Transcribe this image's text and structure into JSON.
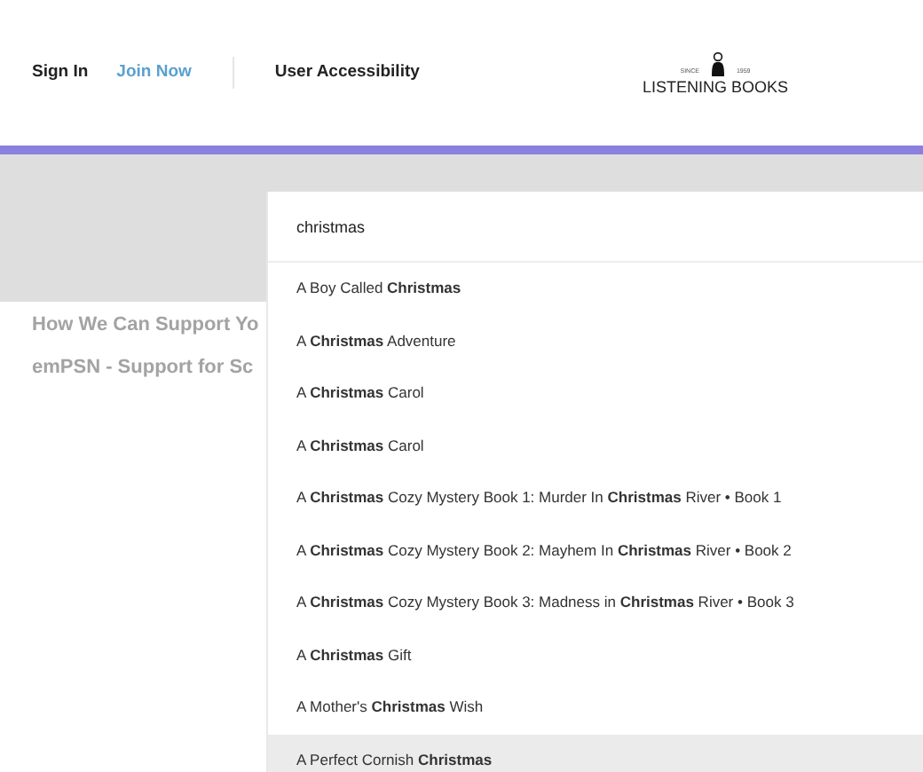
{
  "header": {
    "links": [
      {
        "label": "Sign In",
        "kind": "plain"
      },
      {
        "label": "Join Now",
        "kind": "accent"
      },
      {
        "label": "User Accessibility",
        "kind": "plain"
      }
    ],
    "logo": {
      "since": "SINCE",
      "year": "1959",
      "name": "LISTENING BOOKS"
    }
  },
  "menu_items": [
    "How We Can Support Yo",
    "emPSN - Support for Sc"
  ],
  "search": {
    "value": "christmas",
    "results": [
      {
        "title": "A Boy Called **Christmas**",
        "selected": false
      },
      {
        "title": "A **Christmas** Adventure",
        "selected": false
      },
      {
        "title": "A **Christmas** Carol",
        "selected": false
      },
      {
        "title": "A **Christmas** Carol",
        "selected": false
      },
      {
        "title": "A **Christmas** Cozy Mystery Book 1: Murder In **Christmas** River • Book 1",
        "selected": false
      },
      {
        "title": "A **Christmas** Cozy Mystery Book 2: Mayhem In **Christmas** River • Book 2",
        "selected": false
      },
      {
        "title": "A **Christmas** Cozy Mystery Book 3: Madness in **Christmas** River • Book 3",
        "selected": false
      },
      {
        "title": "A **Christmas** Gift",
        "selected": false
      },
      {
        "title": "A Mother's **Christmas** Wish",
        "selected": false
      },
      {
        "title": "A Perfect Cornish **Christmas**",
        "selected": true
      }
    ]
  }
}
